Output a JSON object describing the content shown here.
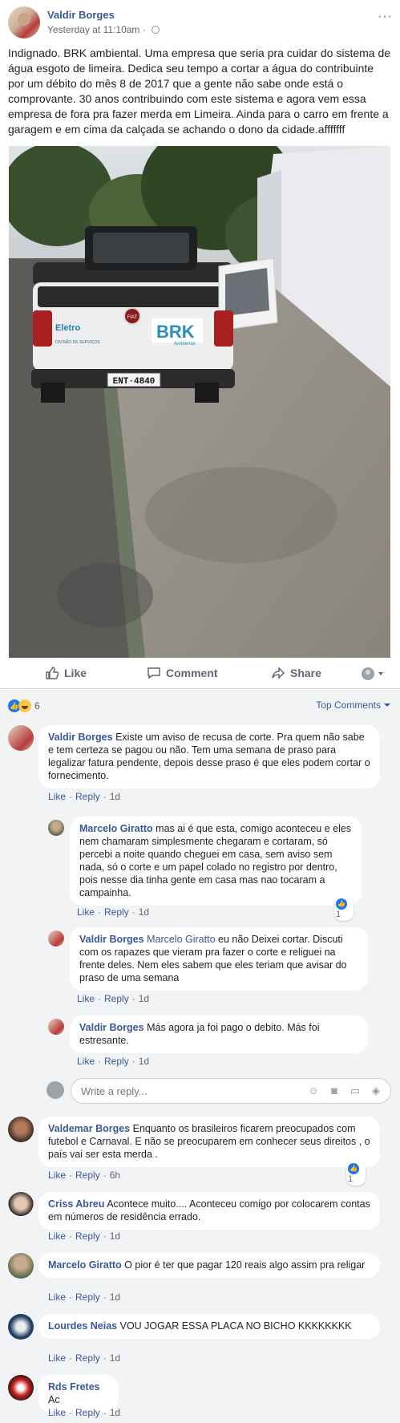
{
  "post": {
    "author": "Valdir Borges",
    "timestamp": "Yesterday at 11:10am",
    "separator": "·",
    "text": "Indignado. BRK ambiental. Uma empresa que seria pra cuidar do sistema de água esgoto de limeira. Dedica seu tempo a cortar a água do contribuinte por um débito do mês 8 de 2017 que a gente não sabe onde está o comprovante. 30 anos contribuindo com este sistema e agora vem essa empresa de fora pra fazer merda em Limeira. Ainda para o carro em frente a garagem e em cima da calçada se achando o dono da cidade.afffffff",
    "more": "···",
    "photo": {
      "plate": "ENT·4840",
      "brk_logo": "BRK",
      "brk_sub": "Ambiental",
      "eletro_logo": "Eletro",
      "eletro_sub": "DIVISÃO DE SERVIÇOS",
      "fiat": "FIAT"
    }
  },
  "actions": {
    "like": "Like",
    "comment": "Comment",
    "share": "Share"
  },
  "reactions": {
    "count": "6",
    "sort_label": "Top Comments"
  },
  "comments": [
    {
      "name": "Valdir Borges",
      "text": "Existe um aviso de recusa de corte. Pra quem não sabe e tem certeza se pagou ou não. Tem uma semana de praso para legalizar fatura pendente, depois desse praso é que eles podem cortar o fornecimento.",
      "like": "Like",
      "reply": "Reply",
      "time": "1d",
      "replies": [
        {
          "name": "Marcelo Giratto",
          "text": "mas ai é que esta, comigo aconteceu e eles nem chamaram simplesmente chegaram e cortaram, só percebi a noite quando cheguei em casa, sem aviso sem nada, só o corte e um papel colado no registro por dentro, pois nesse dia tinha gente em casa mas nao tocaram a campainha.",
          "like": "Like",
          "reply": "Reply",
          "time": "1d",
          "reactions": "1"
        },
        {
          "name": "Valdir Borges",
          "tag": "Marcelo Giratto",
          "text": "eu não Deixei cortar. Discuti com os rapazes que vieram pra fazer o corte e religuei na frente deles. Nem eles sabem que eles teriam que avisar do praso de uma semana",
          "like": "Like",
          "reply": "Reply",
          "time": "1d"
        },
        {
          "name": "Valdir Borges",
          "text": "Más agora ja foi pago o debito. Más foi estresante.",
          "like": "Like",
          "reply": "Reply",
          "time": "1d"
        }
      ]
    },
    {
      "name": "Valdemar Borges",
      "text": "Enquanto os brasileiros ficarem preocupados com futebol e Carnaval. E não se preocuparem em conhecer seus direitos , o país vai ser esta merda .",
      "like": "Like",
      "reply": "Reply",
      "time": "6h",
      "reactions": "1"
    },
    {
      "name": "Criss Abreu",
      "text": "Acontece muito.... Aconteceu comigo por colocarem contas em números de residência errado.",
      "like": "Like",
      "reply": "Reply",
      "time": "1d"
    },
    {
      "name": "Marcelo Giratto",
      "text": "O pior é ter que pagar 120 reais algo assim pra religar",
      "like": "Like",
      "reply": "Reply",
      "time": "1d"
    },
    {
      "name": "Lourdes Neias",
      "text": "VOU JOGAR ESSA PLACA NO BICHO KKKKKKKK",
      "like": "Like",
      "reply": "Reply",
      "time": "1d"
    },
    {
      "name": "Rds Fretes",
      "text": "Ac",
      "like": "Like",
      "reply": "Reply",
      "time": "1d"
    }
  ],
  "reply_box": {
    "placeholder": "Write a reply..."
  },
  "colors": {
    "link": "#385898",
    "meta": "#606770",
    "comment_bg": "#f2f3f5",
    "like_blue": "#1877f2"
  }
}
